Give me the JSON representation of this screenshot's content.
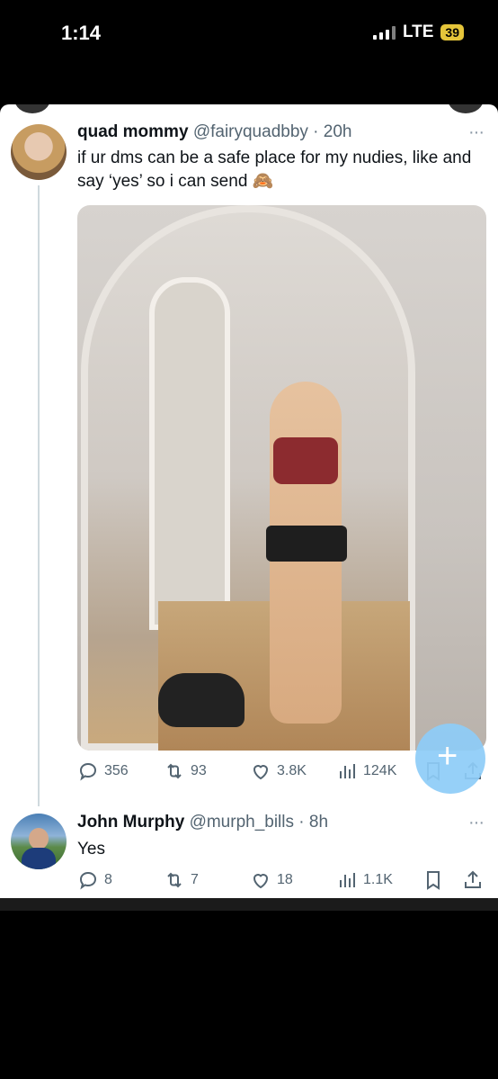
{
  "status_bar": {
    "time": "1:14",
    "network": "LTE",
    "battery": "39"
  },
  "tweet1": {
    "display_name": "quad mommy",
    "handle_time": "@fairyquadbby · 20h",
    "text": "if ur dms can be a safe place for my nudies, like and say ‘yes’ so i can send 🙈",
    "more": "···",
    "replies": "356",
    "retweets": "93",
    "likes": "3.8K",
    "views": "124K"
  },
  "tweet2": {
    "display_name": "John Murphy",
    "handle_time": "@murph_bills · 8h",
    "text": "Yes",
    "more": "···",
    "replies": "8",
    "retweets": "7",
    "likes": "18",
    "views": "1.1K"
  },
  "fab": {
    "label": "+"
  },
  "icons": [
    "reply-icon",
    "retweet-icon",
    "like-icon",
    "views-icon",
    "bookmark-icon",
    "share-icon",
    "compose-icon"
  ]
}
